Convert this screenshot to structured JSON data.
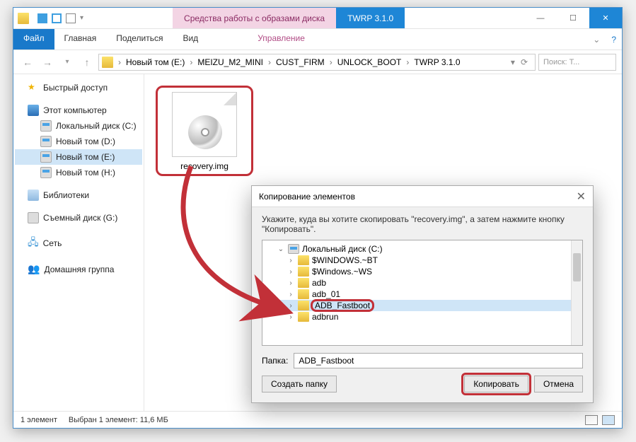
{
  "titlebar": {
    "context_tab": "Средства работы с образами диска",
    "app_tab": "TWRP 3.1.0"
  },
  "win_controls": {
    "min": "—",
    "max": "☐",
    "close": "✕"
  },
  "ribbon": {
    "file": "Файл",
    "home": "Главная",
    "share": "Поделиться",
    "view": "Вид",
    "manage": "Управление",
    "help_icon": "?"
  },
  "nav": {
    "back": "←",
    "fwd": "→",
    "up": "↑",
    "refresh": "⟳",
    "dropdown": "▾"
  },
  "breadcrumb": {
    "items": [
      "Новый том (E:)",
      "MEIZU_M2_MINI",
      "CUST_FIRM",
      "UNLOCK_BOOT",
      "TWRP 3.1.0"
    ],
    "sep": "›"
  },
  "search": {
    "placeholder": "Поиск: T..."
  },
  "sidebar": {
    "quick": "Быстрый доступ",
    "this_pc": "Этот компьютер",
    "drives": [
      "Локальный диск (C:)",
      "Новый том (D:)",
      "Новый том (E:)",
      "Новый том (H:)"
    ],
    "libraries": "Библиотеки",
    "removable": "Съемный диск (G:)",
    "network": "Сеть",
    "homegroup": "Домашняя группа"
  },
  "file": {
    "name": "recovery.img"
  },
  "status": {
    "count": "1 элемент",
    "selected": "Выбран 1 элемент: 11,6 МБ"
  },
  "dialog": {
    "title": "Копирование элементов",
    "msg": "Укажите, куда вы хотите скопировать \"recovery.img\", а затем нажмите кнопку \"Копировать\".",
    "tree_root": "Локальный диск (C:)",
    "tree_items": [
      "$WINDOWS.~BT",
      "$Windows.~WS",
      "adb",
      "adb_01",
      "ADB_Fastboot",
      "adbrun"
    ],
    "folder_label": "Папка:",
    "folder_value": "ADB_Fastboot",
    "btn_new": "Создать папку",
    "btn_copy": "Копировать",
    "btn_cancel": "Отмена",
    "close": "✕",
    "caret_open": "⌄",
    "caret_closed": "›"
  }
}
